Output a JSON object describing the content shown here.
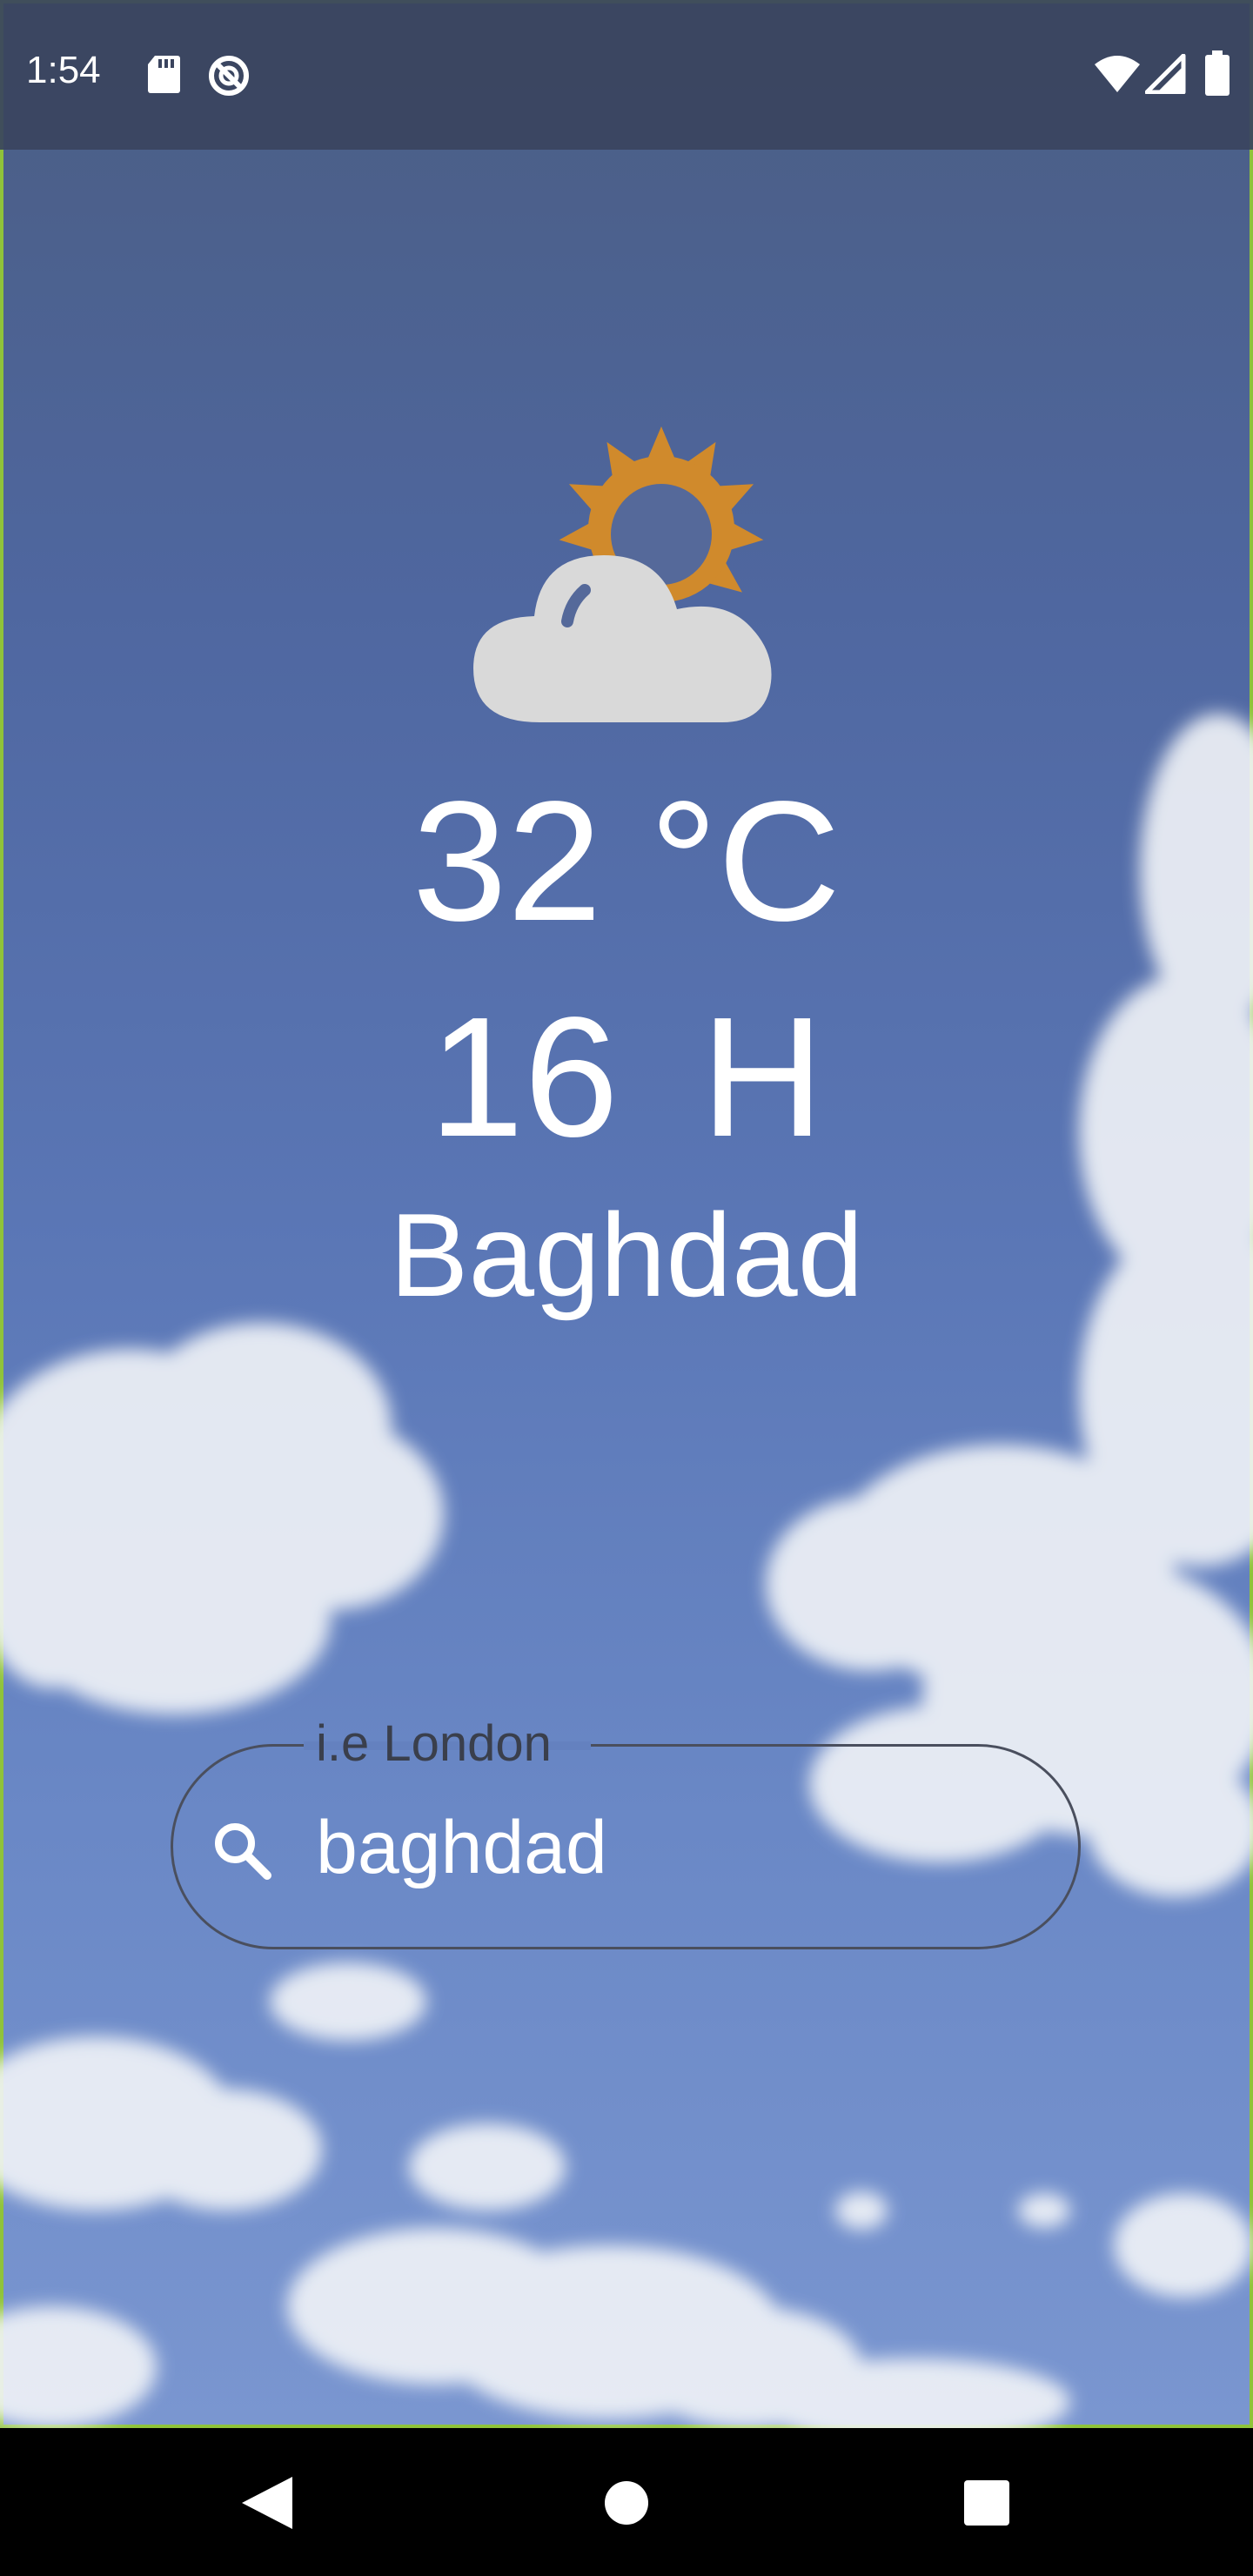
{
  "status_bar": {
    "time": "1:54",
    "left_icons": [
      "sd-card-icon",
      "no-sync-icon"
    ],
    "right_icons": [
      "wifi-icon",
      "signal-icon",
      "battery-icon"
    ]
  },
  "weather": {
    "icon": "partly-cloudy-icon",
    "temperature": "32 °C",
    "humidity": "16  H",
    "city": "Baghdad"
  },
  "search": {
    "label": "i.e London",
    "value": "baghdad",
    "icon": "search-icon"
  },
  "nav_bar": {
    "icons": [
      "back-icon",
      "home-icon",
      "recents-icon"
    ]
  },
  "colors": {
    "sun": "#d08a2c",
    "cloud": "#d9d9d9",
    "text": "#ffffff",
    "status_bar": "#3a445e",
    "frame_accent": "#8fc33a"
  }
}
